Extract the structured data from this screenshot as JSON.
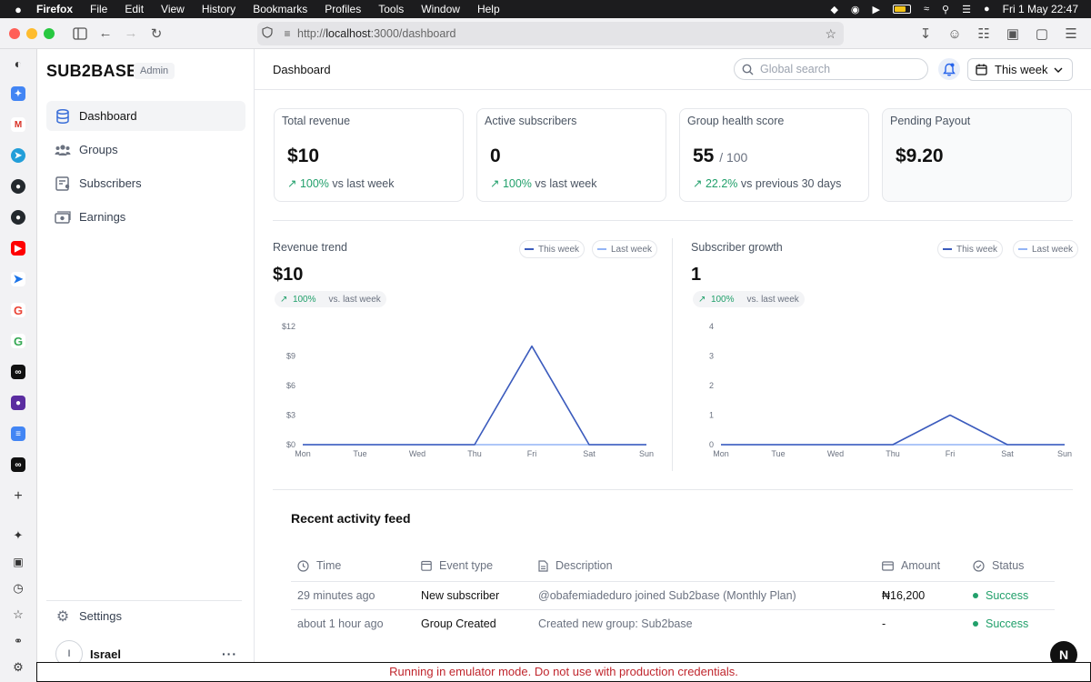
{
  "menubar": {
    "app": "Firefox",
    "items": [
      "File",
      "Edit",
      "View",
      "History",
      "Bookmarks",
      "Profiles",
      "Tools",
      "Window",
      "Help"
    ],
    "clock": "Fri 1 May  22:47"
  },
  "browser": {
    "url_prefix": "http://",
    "url_host": "localhost",
    "url_rest": ":3000/dashboard"
  },
  "brand": {
    "name": "SUB2BASE",
    "badge": "Admin"
  },
  "sidebar": {
    "items": [
      {
        "label": "Dashboard",
        "icon": "database-icon",
        "active": true
      },
      {
        "label": "Groups",
        "icon": "users-icon",
        "active": false
      },
      {
        "label": "Subscribers",
        "icon": "subscribers-icon",
        "active": false
      },
      {
        "label": "Earnings",
        "icon": "cash-icon",
        "active": false
      }
    ],
    "settings_label": "Settings",
    "user": {
      "initial": "I",
      "name": "Israel",
      "more": "···"
    }
  },
  "header": {
    "title": "Dashboard",
    "search_placeholder": "Global search",
    "period": "This week"
  },
  "stats": [
    {
      "title": "Total revenue",
      "value": "$10",
      "delta": "100%",
      "delta_text": "vs last week"
    },
    {
      "title": "Active subscribers",
      "value": "0",
      "delta": "100%",
      "delta_text": "vs last week"
    },
    {
      "title": "Group health score",
      "value": "55",
      "denominator": "/ 100",
      "delta": "22.2%",
      "delta_text": "vs previous 30 days"
    },
    {
      "title": "Pending Payout",
      "value": "$9.20"
    }
  ],
  "chart_data": [
    {
      "type": "line",
      "title": "Revenue trend",
      "value": "$10",
      "delta": "100%",
      "delta_text": "vs. last week",
      "legend": [
        "This week",
        "Last week"
      ],
      "x": [
        "Mon",
        "Tue",
        "Wed",
        "Thu",
        "Fri",
        "Sat",
        "Sun"
      ],
      "ytick_labels": [
        "$0",
        "$3",
        "$6",
        "$9",
        "$12"
      ],
      "ylim": [
        0,
        12
      ],
      "series": [
        {
          "name": "This week",
          "color": "#3b5bbd",
          "values": [
            0,
            0,
            0,
            0,
            10,
            0,
            0
          ]
        },
        {
          "name": "Last week",
          "color": "#93b4f5",
          "values": [
            0,
            0,
            0,
            0,
            0,
            0,
            0
          ]
        }
      ]
    },
    {
      "type": "line",
      "title": "Subscriber growth",
      "value": "1",
      "delta": "100%",
      "delta_text": "vs. last week",
      "legend": [
        "This week",
        "Last week"
      ],
      "x": [
        "Mon",
        "Tue",
        "Wed",
        "Thu",
        "Fri",
        "Sat",
        "Sun"
      ],
      "ytick_labels": [
        "0",
        "1",
        "2",
        "3",
        "4"
      ],
      "ylim": [
        0,
        4
      ],
      "series": [
        {
          "name": "This week",
          "color": "#3b5bbd",
          "values": [
            0,
            0,
            0,
            0,
            1,
            0,
            0
          ]
        },
        {
          "name": "Last week",
          "color": "#93b4f5",
          "values": [
            0,
            0,
            0,
            0,
            0,
            0,
            0
          ]
        }
      ]
    }
  ],
  "feed": {
    "title": "Recent activity feed",
    "columns": [
      "Time",
      "Event type",
      "Description",
      "Amount",
      "Status"
    ],
    "rows": [
      {
        "time": "29 minutes ago",
        "event": "New subscriber",
        "description": "@obafemiadeduro joined Sub2base (Monthly Plan)",
        "amount": "₦16,200",
        "status": "Success"
      },
      {
        "time": "about 1 hour ago",
        "event": "Group Created",
        "description": "Created new group: Sub2base",
        "amount": "-",
        "status": "Success"
      }
    ]
  },
  "banner": "Running in emulator mode. Do not use with production credentials.",
  "dev_badge": "N"
}
